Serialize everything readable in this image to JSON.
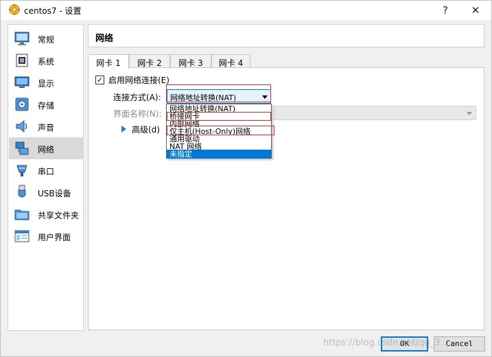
{
  "window": {
    "title": "centos7 - 设置",
    "help_glyph": "?",
    "close_glyph": "✕"
  },
  "sidebar": {
    "items": [
      {
        "label": "常规",
        "icon": "general-icon"
      },
      {
        "label": "系统",
        "icon": "system-icon"
      },
      {
        "label": "显示",
        "icon": "display-icon"
      },
      {
        "label": "存储",
        "icon": "storage-icon"
      },
      {
        "label": "声音",
        "icon": "audio-icon"
      },
      {
        "label": "网络",
        "icon": "network-icon",
        "selected": true
      },
      {
        "label": "串口",
        "icon": "serial-port-icon"
      },
      {
        "label": "USB设备",
        "icon": "usb-icon"
      },
      {
        "label": "共享文件夹",
        "icon": "shared-folder-icon"
      },
      {
        "label": "用户界面",
        "icon": "user-interface-icon"
      }
    ]
  },
  "main": {
    "section_title": "网络",
    "tabs": [
      {
        "label": "网卡 1",
        "active": true
      },
      {
        "label": "网卡 2"
      },
      {
        "label": "网卡 3"
      },
      {
        "label": "网卡 4"
      }
    ],
    "enable_checkbox": {
      "label": "启用网络连接(E)",
      "checked": true,
      "check_glyph": "✓"
    },
    "attached_to": {
      "label": "连接方式(A):",
      "value": "网络地址转换(NAT)"
    },
    "interface_name": {
      "label": "界面名称(N):",
      "value": ""
    },
    "advanced": {
      "label": "高级(d)"
    },
    "dropdown_options": [
      "网络地址转换(NAT)",
      "桥接网卡",
      "内部网络",
      "仅主机(Host-Only)网络",
      "通用驱动",
      "NAT 网络",
      "未指定"
    ],
    "highlighted_option_index": 6
  },
  "buttons": {
    "ok": "OK",
    "cancel": "Cancel"
  },
  "watermark": "https://blog.csdn.net/qq_3..."
}
